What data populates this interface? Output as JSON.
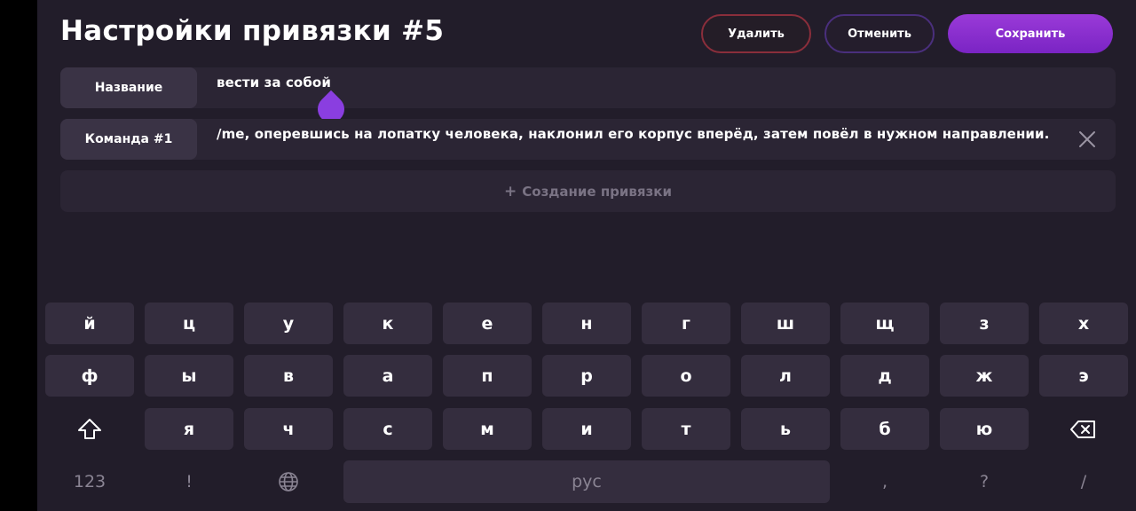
{
  "title": "Настройки привязки #5",
  "buttons": {
    "delete": "Удалить",
    "cancel": "Отменить",
    "save": "Сохранить"
  },
  "fields": {
    "name": {
      "label": "Название",
      "value": "вести за собой"
    },
    "command": {
      "label": "Команда #1",
      "value": "/me, оперевшись на лопатку человека, наклонил его корпус вперёд, затем повёл в нужном направлении."
    }
  },
  "add_binding": "Создание привязки",
  "keyboard": {
    "row1": [
      "й",
      "ц",
      "у",
      "к",
      "е",
      "н",
      "г",
      "ш",
      "щ",
      "з",
      "х"
    ],
    "row2": [
      "ф",
      "ы",
      "в",
      "а",
      "п",
      "р",
      "о",
      "л",
      "д",
      "ж",
      "э"
    ],
    "row3": [
      "я",
      "ч",
      "с",
      "м",
      "и",
      "т",
      "ь",
      "б",
      "ю"
    ],
    "numbers": "123",
    "exclamation": "!",
    "space": "рус",
    "comma": ",",
    "question": "?",
    "slash": "/"
  },
  "icons": {
    "close": "close-icon",
    "shift": "shift-icon",
    "backspace": "backspace-icon",
    "globe": "globe-icon",
    "plus": "plus-icon"
  },
  "colors": {
    "accent": "#8a3ee0",
    "delete_border": "#8a2e3b",
    "cancel_border": "#4a2f7d"
  }
}
